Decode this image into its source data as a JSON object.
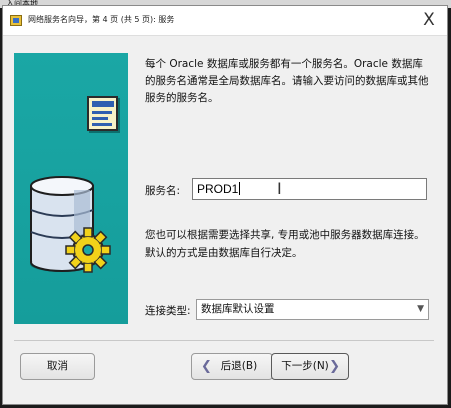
{
  "background": {
    "label": "入间本地"
  },
  "window": {
    "title": "网络服务名向导，第 4 页 (共 5 页): 服务",
    "close_glyph": "X"
  },
  "content": {
    "description": "每个 Oracle 数据库或服务都有一个服务名。Oracle 数据库的服务名通常是全局数据库名。请输入要访问的数据库或其他服务的服务名。",
    "service_name_label": "服务名:",
    "service_name_value": "PROD1",
    "description2": "您也可以根据需要选择共享, 专用或池中服务器数据库连接。默认的方式是由数据库自行决定。",
    "connection_type_label": "连接类型:",
    "connection_type_value": "数据库默认设置"
  },
  "buttons": {
    "cancel": "取消",
    "back": "后退(B)",
    "next": "下一步(N)"
  },
  "icons": {
    "close": "close-icon",
    "document": "document-card-icon",
    "database": "database-gear-icon",
    "back": "chevron-left-icon",
    "next": "chevron-right-icon",
    "dropdown": "chevron-down-icon",
    "cursor": "text-cursor-ibeam-icon"
  },
  "colors": {
    "side_panel": "#1aa7a5",
    "window_bg": "#f0f0f0",
    "gear": "#f2d21a"
  }
}
